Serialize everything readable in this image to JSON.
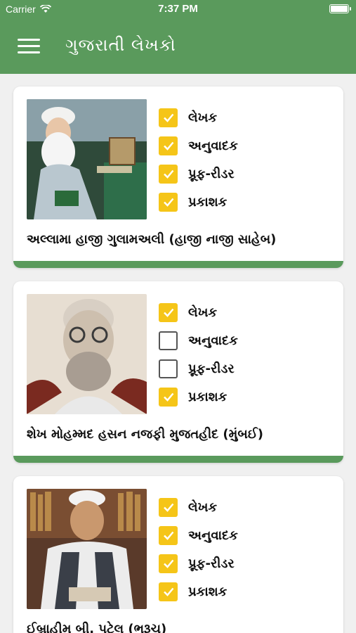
{
  "status_bar": {
    "carrier": "Carrier",
    "time": "7:37 PM"
  },
  "nav": {
    "title": "ગુજરાતી લેખકો",
    "menu_icon": "hamburger-menu-icon"
  },
  "colors": {
    "primary": "#5a9a5c",
    "checkbox_checked": "#f5c518"
  },
  "cards": [
    {
      "name": "અલ્લામા હાજી ગુલામઅલી (હાજી નાજી સાહેબ)",
      "roles": [
        {
          "label": "લેખક",
          "checked": true
        },
        {
          "label": "અનુવાદક",
          "checked": true
        },
        {
          "label": "પ્રૂફ-રીડર",
          "checked": true
        },
        {
          "label": "પ્રકાશક",
          "checked": true
        }
      ]
    },
    {
      "name": "શેખ મોહમ્મદ હસન નજફી મુજતહીદ (મુંબઈ)",
      "roles": [
        {
          "label": "લેખક",
          "checked": true
        },
        {
          "label": "અનુવાદક",
          "checked": false
        },
        {
          "label": "પ્રૂફ-રીડર",
          "checked": false
        },
        {
          "label": "પ્રકાશક",
          "checked": true
        }
      ]
    },
    {
      "name": "ઈબ્રાહીમ બી. પટેલ (ભરૂચ)",
      "roles": [
        {
          "label": "લેખક",
          "checked": true
        },
        {
          "label": "અનુવાદક",
          "checked": true
        },
        {
          "label": "પ્રૂફ-રીડર",
          "checked": true
        },
        {
          "label": "પ્રકાશક",
          "checked": true
        }
      ]
    }
  ]
}
